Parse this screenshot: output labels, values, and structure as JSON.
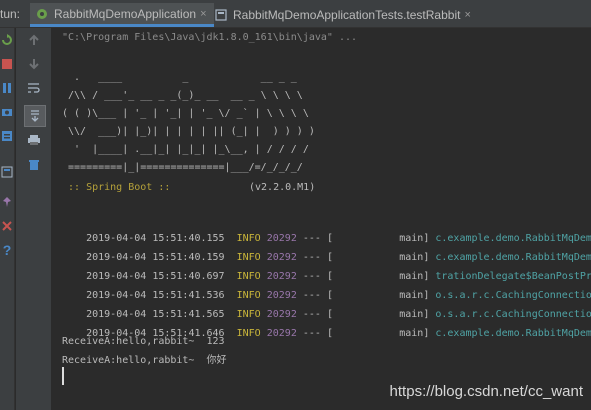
{
  "tabs": {
    "run_label": "tun:",
    "active_tab": "RabbitMqDemoApplication",
    "inactive_tab": "RabbitMqDemoApplicationTests.testRabbit"
  },
  "console": {
    "command": "\"C:\\Program Files\\Java\\jdk1.8.0_161\\bin\\java\" ...",
    "banner": [
      "  .   ____          _            __ _ _",
      " /\\\\ / ___'_ __ _ _(_)_ __  __ _ \\ \\ \\ \\",
      "( ( )\\___ | '_ | '_| | '_ \\/ _` | \\ \\ \\ \\",
      " \\\\/  ___)| |_)| | | | | || (_| |  ) ) ) )",
      "  '  |____| .__|_| |_|_| |_\\__, | / / / /",
      " =========|_|==============|___/=/_/_/_/"
    ],
    "spring_boot": " :: Spring Boot ::",
    "version": "(v2.2.0.M1)",
    "logs": [
      {
        "ts": "2019-04-04 15:51:40.155",
        "level": "INFO",
        "pid": "20292",
        "sep": "---",
        "thread": "[           main]",
        "logger": "c.example.demo.RabbitMqDemoApp"
      },
      {
        "ts": "2019-04-04 15:51:40.159",
        "level": "INFO",
        "pid": "20292",
        "sep": "---",
        "thread": "[           main]",
        "logger": "c.example.demo.RabbitMqDemoApp"
      },
      {
        "ts": "2019-04-04 15:51:40.697",
        "level": "INFO",
        "pid": "20292",
        "sep": "---",
        "thread": "[           main]",
        "logger": "trationDelegate$BeanPostProces"
      },
      {
        "ts": "2019-04-04 15:51:41.536",
        "level": "INFO",
        "pid": "20292",
        "sep": "---",
        "thread": "[           main]",
        "logger": "o.s.a.r.c.CachingConnectionFac"
      },
      {
        "ts": "2019-04-04 15:51:41.565",
        "level": "INFO",
        "pid": "20292",
        "sep": "---",
        "thread": "[           main]",
        "logger": "o.s.a.r.c.CachingConnectionFac"
      },
      {
        "ts": "2019-04-04 15:51:41.646",
        "level": "INFO",
        "pid": "20292",
        "sep": "---",
        "thread": "[           main]",
        "logger": "c.example.demo.RabbitMqDemoApp"
      }
    ],
    "output_lines": [
      "ReceiveA:hello,rabbit~  123",
      "ReceiveA:hello,rabbit~  你好"
    ]
  },
  "watermark": "https://blog.csdn.net/cc_want",
  "colors": {
    "info": "#c9b53a",
    "pid": "#9876aa",
    "logger": "#4fa3a5",
    "spring": "#b5a13a"
  }
}
